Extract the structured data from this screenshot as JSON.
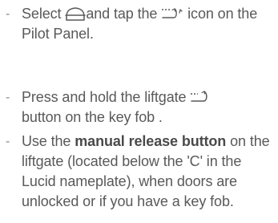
{
  "instructions": {
    "dash": "-",
    "item_1": {
      "part_1": "Select",
      "icon_1": "vehicle-outline-icon",
      "part_2": "and tap the",
      "icon_2": "liftgate-open-icon",
      "part_3": "icon on the Pilot Panel."
    },
    "item_2": {
      "part_1": "Press and hold the liftgate",
      "icon_1": "liftgate-open-icon",
      "part_2": "button on the key fob ."
    },
    "item_3": {
      "part_1": "Use the",
      "bold": "manual release button",
      "part_2": "on the liftgate (located below the 'C' in the Lucid nameplate), when doors are unlocked or if you have a key fob."
    }
  },
  "colors": {
    "text": "#595959",
    "bold_text": "#4a4a4a",
    "bullet": "#8a8a8a"
  }
}
